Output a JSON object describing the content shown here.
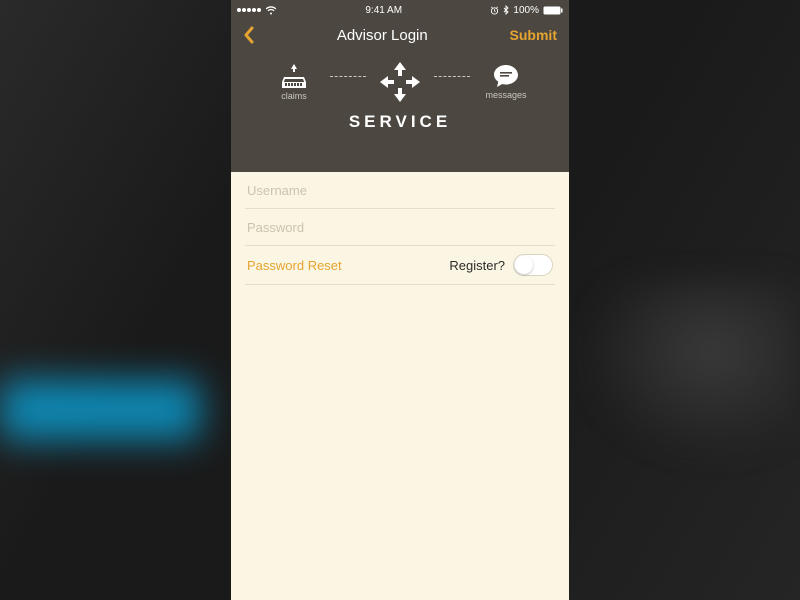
{
  "status": {
    "time": "9:41 AM",
    "battery": "100%"
  },
  "nav": {
    "title": "Advisor Login",
    "submit": "Submit"
  },
  "service": {
    "claims_label": "claims",
    "messages_label": "messages",
    "title": "SERVICE"
  },
  "form": {
    "username_placeholder": "Username",
    "password_placeholder": "Password",
    "reset_label": "Password Reset",
    "register_label": "Register?"
  }
}
